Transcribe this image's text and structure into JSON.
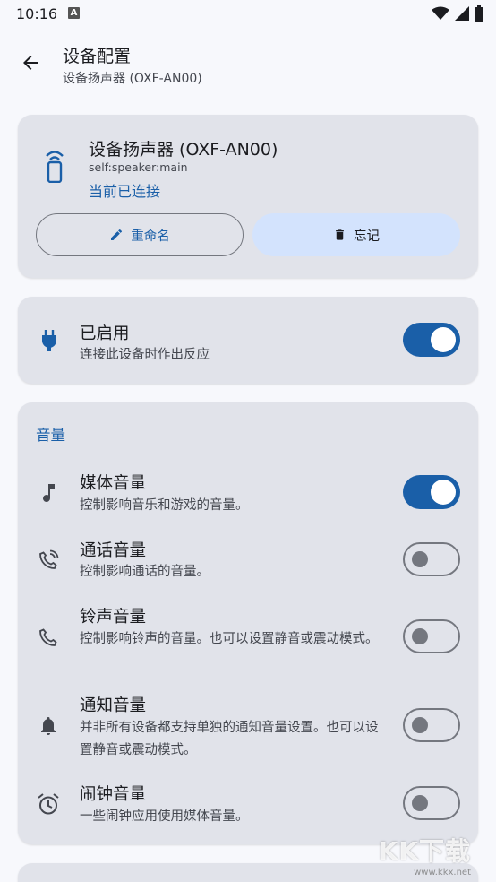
{
  "status_bar": {
    "time": "10:16",
    "notification": "A"
  },
  "app_bar": {
    "title": "设备配置",
    "subtitle": "设备扬声器 (OXF-AN00)"
  },
  "device": {
    "name": "设备扬声器 (OXF-AN00)",
    "id": "self:speaker:main",
    "status": "当前已连接",
    "rename_label": "重命名",
    "forget_label": "忘记"
  },
  "enabled": {
    "title": "已启用",
    "desc": "连接此设备时作出反应",
    "on": true
  },
  "volume": {
    "header": "音量",
    "items": [
      {
        "title": "媒体音量",
        "desc": "控制影响音乐和游戏的音量。",
        "on": true
      },
      {
        "title": "通话音量",
        "desc": "控制影响通话的音量。",
        "on": false
      },
      {
        "title": "铃声音量",
        "desc": "控制影响铃声的音量。也可以设置静音或震动模式。",
        "on": false
      },
      {
        "title": "通知音量",
        "desc": "并非所有设备都支持单独的通知音量设置。也可以设置静音或震动模式。",
        "on": false
      },
      {
        "title": "闹钟音量",
        "desc": "一些闹钟应用使用媒体音量。",
        "on": false
      }
    ]
  },
  "watermark": {
    "text": "KK下载",
    "url": "www.kkx.net"
  },
  "colors": {
    "accent": "#1a5fa8",
    "card": "#e1e3ea",
    "background": "#f7f8fc",
    "tonal_button": "#d3e3fd"
  }
}
